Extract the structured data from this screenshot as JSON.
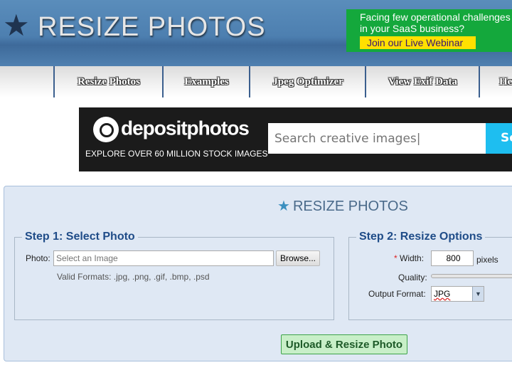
{
  "header": {
    "title": "RESIZE PHOTOS",
    "logo_icon": "star-icon"
  },
  "ad": {
    "line1": "Facing few operational challenges",
    "line2": "in your SaaS business?",
    "cta": "Join our Live Webinar",
    "bg_color": "#14a83c",
    "cta_color": "#ffe000"
  },
  "nav": {
    "items": [
      {
        "label": "Resize Photos"
      },
      {
        "label": "Examples"
      },
      {
        "label": "Jpeg Optimizer"
      },
      {
        "label": "View Exif Data"
      },
      {
        "label": "He"
      }
    ]
  },
  "banner": {
    "brand": "depositphotos",
    "tagline": "EXPLORE OVER 60 MILLION STOCK IMAGES",
    "search_placeholder": "Search creative images|",
    "search_button": "Se"
  },
  "main": {
    "title": "RESIZE PHOTOS",
    "step1": {
      "legend": "Step 1: Select Photo",
      "photo_label": "Photo:",
      "photo_placeholder": "Select an Image",
      "browse": "Browse...",
      "valid_formats": "Valid Formats: .jpg, .png, .gif, .bmp, .psd"
    },
    "step2": {
      "legend": "Step 2: Resize Options",
      "required_mark": "*",
      "width_label": "Width:",
      "width_value": "800",
      "width_unit": "pixels",
      "quality_label": "Quality:",
      "output_label": "Output Format:",
      "output_value": "JPG"
    },
    "upload": "Upload & Resize Photo"
  }
}
